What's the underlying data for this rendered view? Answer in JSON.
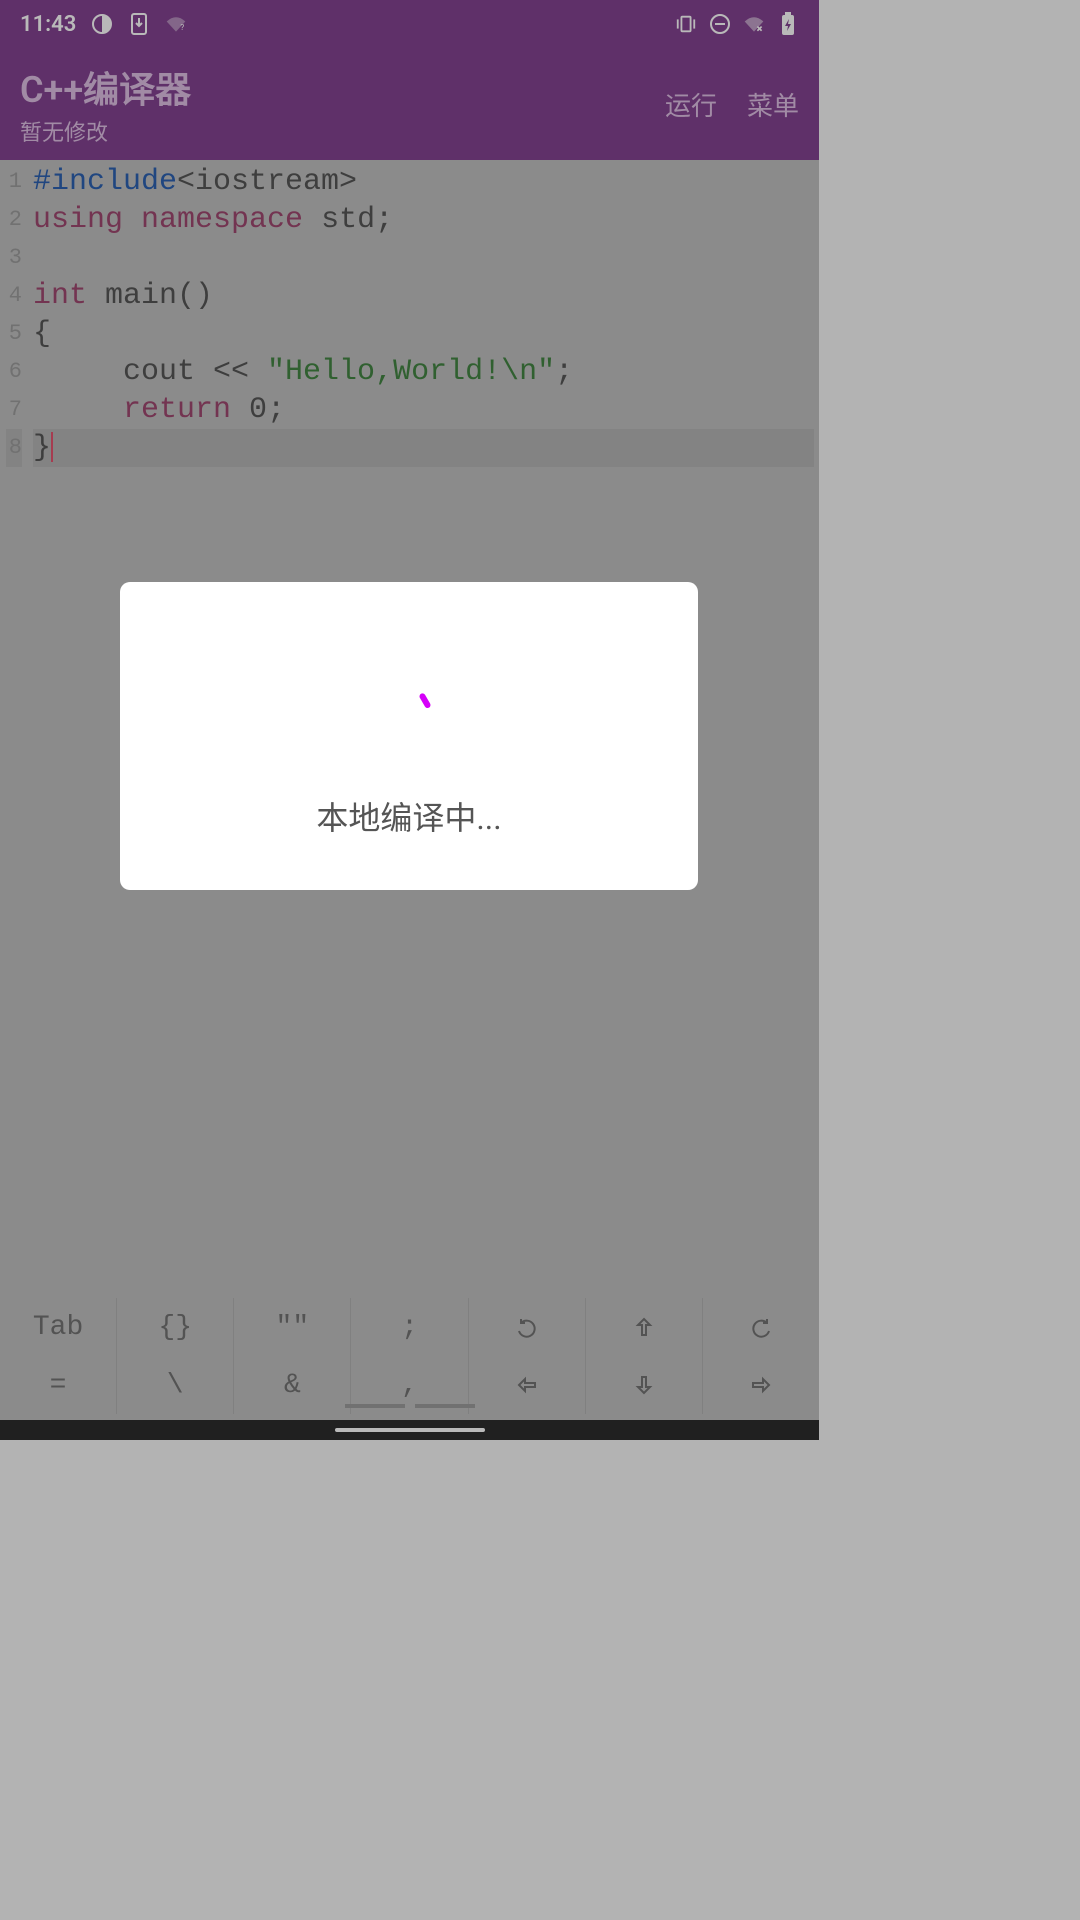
{
  "status": {
    "time": "11:43"
  },
  "appbar": {
    "title": "C++编译器",
    "subtitle": "暂无修改",
    "run": "运行",
    "menu": "菜单"
  },
  "editor": {
    "lines": [
      {
        "n": "1"
      },
      {
        "n": "2"
      },
      {
        "n": "3"
      },
      {
        "n": "4"
      },
      {
        "n": "5"
      },
      {
        "n": "6"
      },
      {
        "n": "7"
      },
      {
        "n": "8"
      }
    ],
    "code": {
      "l1_include": "#include",
      "l1_header": "<iostream>",
      "l2_using": "using",
      "l2_namespace": "namespace",
      "l2_std": "std",
      "l2_semi": ";",
      "l4_int": "int",
      "l4_main": "main()",
      "l5_brace": "{",
      "l6_indent": "     ",
      "l6_cout": "cout",
      "l6_op": " << ",
      "l6_string": "\"Hello,World!\\n\"",
      "l6_semi": ";",
      "l7_indent": "     ",
      "l7_return": "return",
      "l7_zero": " 0",
      "l7_semi": ";",
      "l8_brace": "}"
    }
  },
  "modal": {
    "text": "本地编译中..."
  },
  "toolbar": {
    "row1": {
      "k0": "Tab",
      "k1": "{}",
      "k2": "\"\"",
      "k3": ";"
    },
    "row2": {
      "k0": "=",
      "k1": "\\",
      "k2": "&",
      "k3": ","
    }
  }
}
